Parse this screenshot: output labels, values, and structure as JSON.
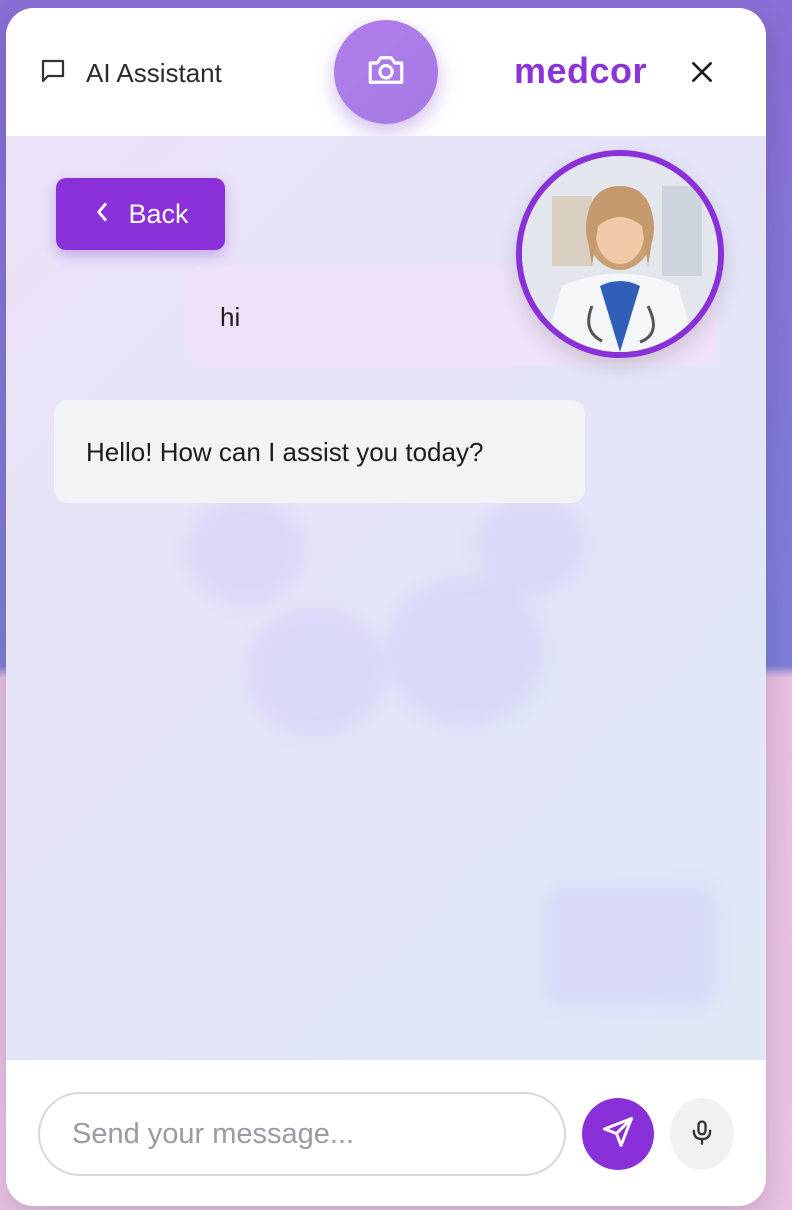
{
  "header": {
    "title": "AI Assistant",
    "brand": "medcor",
    "icons": {
      "chat": "chat-bubble-icon",
      "camera": "camera-icon",
      "close": "close-icon"
    }
  },
  "chat": {
    "back_label": "Back",
    "messages": [
      {
        "role": "user",
        "text": "hi"
      },
      {
        "role": "assistant",
        "text": "Hello! How can I assist you today?"
      }
    ],
    "avatar": "doctor-avatar"
  },
  "composer": {
    "placeholder": "Send your message...",
    "value": "",
    "send_icon": "send-icon",
    "mic_icon": "microphone-icon"
  },
  "colors": {
    "accent": "#8a30d8",
    "camera_button": "#b07de9",
    "user_bubble": "#eee2f8",
    "assistant_bubble": "#f2f3f5"
  }
}
